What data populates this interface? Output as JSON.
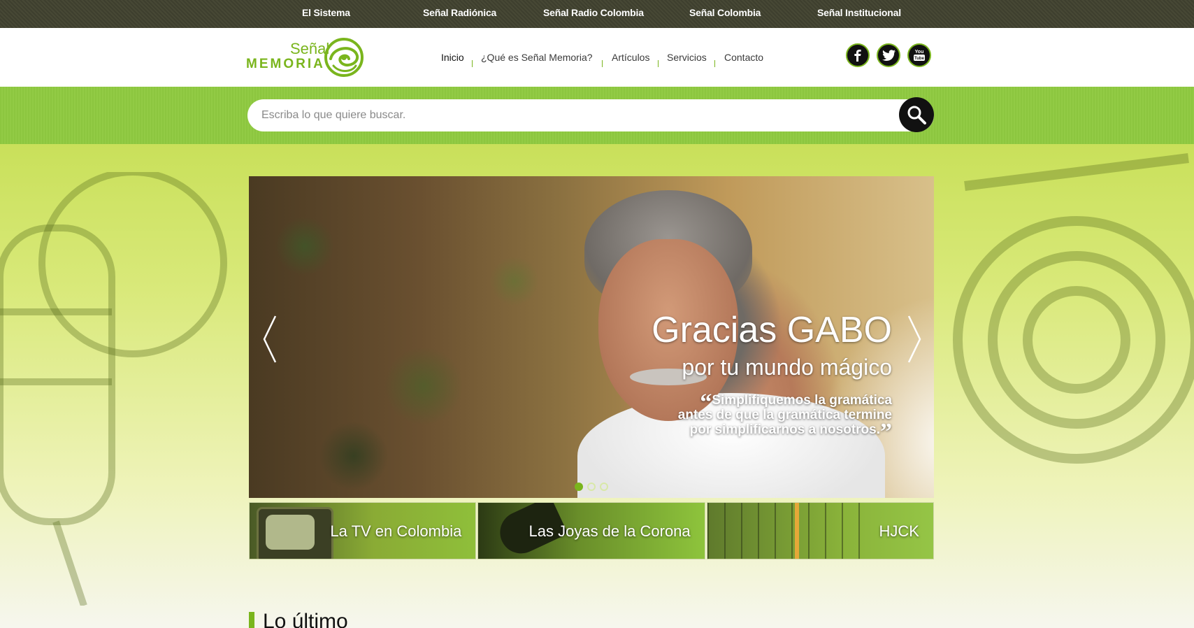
{
  "topbar": {
    "links": [
      "El Sistema",
      "Señal Radiónica",
      "Señal Radio Colombia",
      "Señal Colombia",
      "Señal Institucional"
    ]
  },
  "logo": {
    "line1": "Señal",
    "line2": "MEMORIA"
  },
  "nav": {
    "items": [
      "Inicio",
      "¿Qué es Señal Memoria?",
      "Artículos",
      "Servicios",
      "Contacto"
    ],
    "active": "Inicio"
  },
  "social": {
    "icons": [
      "facebook-icon",
      "twitter-icon",
      "youtube-icon"
    ],
    "youtube_text": "You\nTube"
  },
  "search": {
    "placeholder": "Escriba lo que quiere buscar."
  },
  "slider": {
    "headline": "Gracias GABO",
    "subline": "por tu mundo mágico",
    "quote_lines": [
      "Simplifiquemos la gramática",
      "antes de que la gramática termine",
      "por simplificarnos a nosotros."
    ],
    "quote_open": "“",
    "quote_close": "”",
    "slide_count": 3,
    "active_slide": 1
  },
  "tiles": [
    {
      "label": "La TV en Colombia"
    },
    {
      "label": "Las Joyas de la Corona"
    },
    {
      "label": "HJCK"
    }
  ],
  "section": {
    "title": "Lo último"
  },
  "colors": {
    "brand_green": "#7ab51d",
    "topbar": "#424331"
  }
}
